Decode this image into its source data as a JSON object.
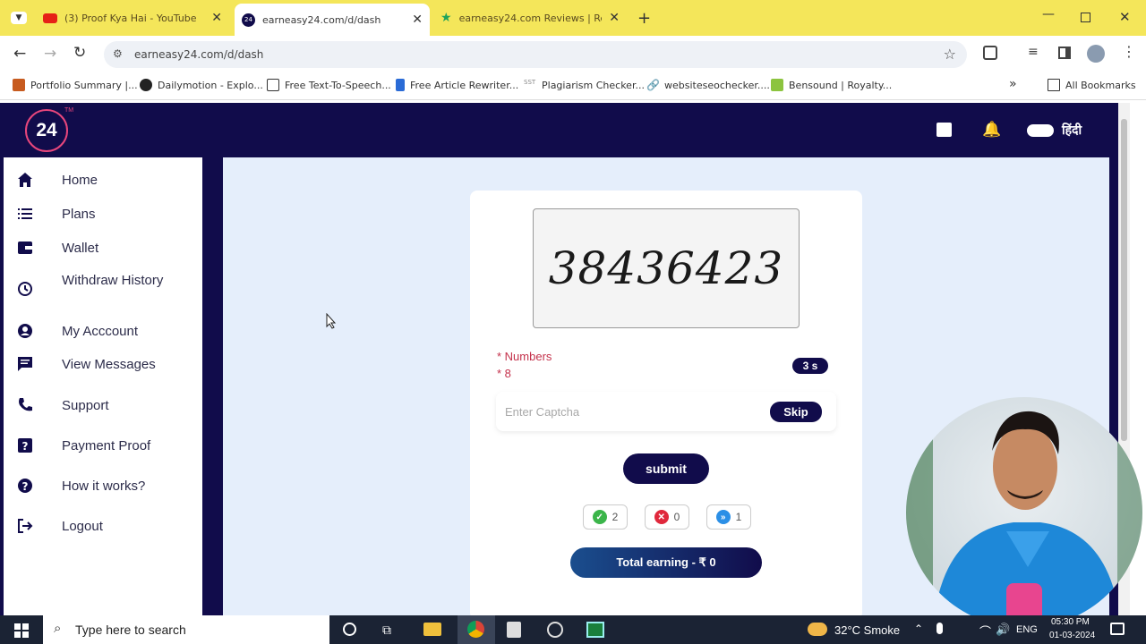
{
  "browser": {
    "tabs": [
      {
        "title": "(3) Proof Kya Hai - YouTube",
        "icon": "youtube-icon"
      },
      {
        "title": "earneasy24.com/d/dash",
        "icon": "site-24-icon"
      },
      {
        "title": "earneasy24.com Reviews | Read",
        "icon": "trustpilot-star-icon"
      }
    ],
    "url": "earneasy24.com/d/dash",
    "bookmarks": [
      "Portfolio Summary |...",
      "Dailymotion - Explo...",
      "Free Text-To-Speech...",
      "Free Article Rewriter...",
      "Plagiarism Checker...",
      "websiteseochecker....",
      "Bensound | Royalty..."
    ],
    "all_bookmarks": "All Bookmarks"
  },
  "site": {
    "logo": "24",
    "logo_tm": "TM",
    "language_label": "हिंदी",
    "nav": [
      {
        "label": "Home",
        "icon": "home-icon"
      },
      {
        "label": "Plans",
        "icon": "list-icon"
      },
      {
        "label": "Wallet",
        "icon": "wallet-icon"
      },
      {
        "label": "Withdraw History",
        "icon": "history-icon"
      },
      {
        "label": "My Acccount",
        "icon": "account-icon"
      },
      {
        "label": "View Messages",
        "icon": "message-icon"
      },
      {
        "label": "Support",
        "icon": "phone-icon"
      },
      {
        "label": "Payment Proof",
        "icon": "question-box-icon"
      },
      {
        "label": "How it works?",
        "icon": "help-icon"
      },
      {
        "label": "Logout",
        "icon": "logout-icon"
      }
    ],
    "captcha": {
      "text": "38436423",
      "rule_type": "* Numbers",
      "rule_length": "* 8",
      "timer": "3 s",
      "placeholder": "Enter Captcha",
      "skip_label": "Skip",
      "submit_label": "submit",
      "stats": {
        "correct": "2",
        "wrong": "0",
        "skipped": "1"
      },
      "total_earning": "Total earning - ₹ 0"
    }
  },
  "taskbar": {
    "search_placeholder": "Type here to search",
    "weather": "32°C  Smoke",
    "language": "ENG",
    "time": "05:30 PM",
    "date": "01-03-2024"
  },
  "colors": {
    "navy": "#110c4b",
    "accent_pink": "#e8467c",
    "chrome_yellow": "#f4e65a",
    "main_bg": "#e5eefb"
  }
}
